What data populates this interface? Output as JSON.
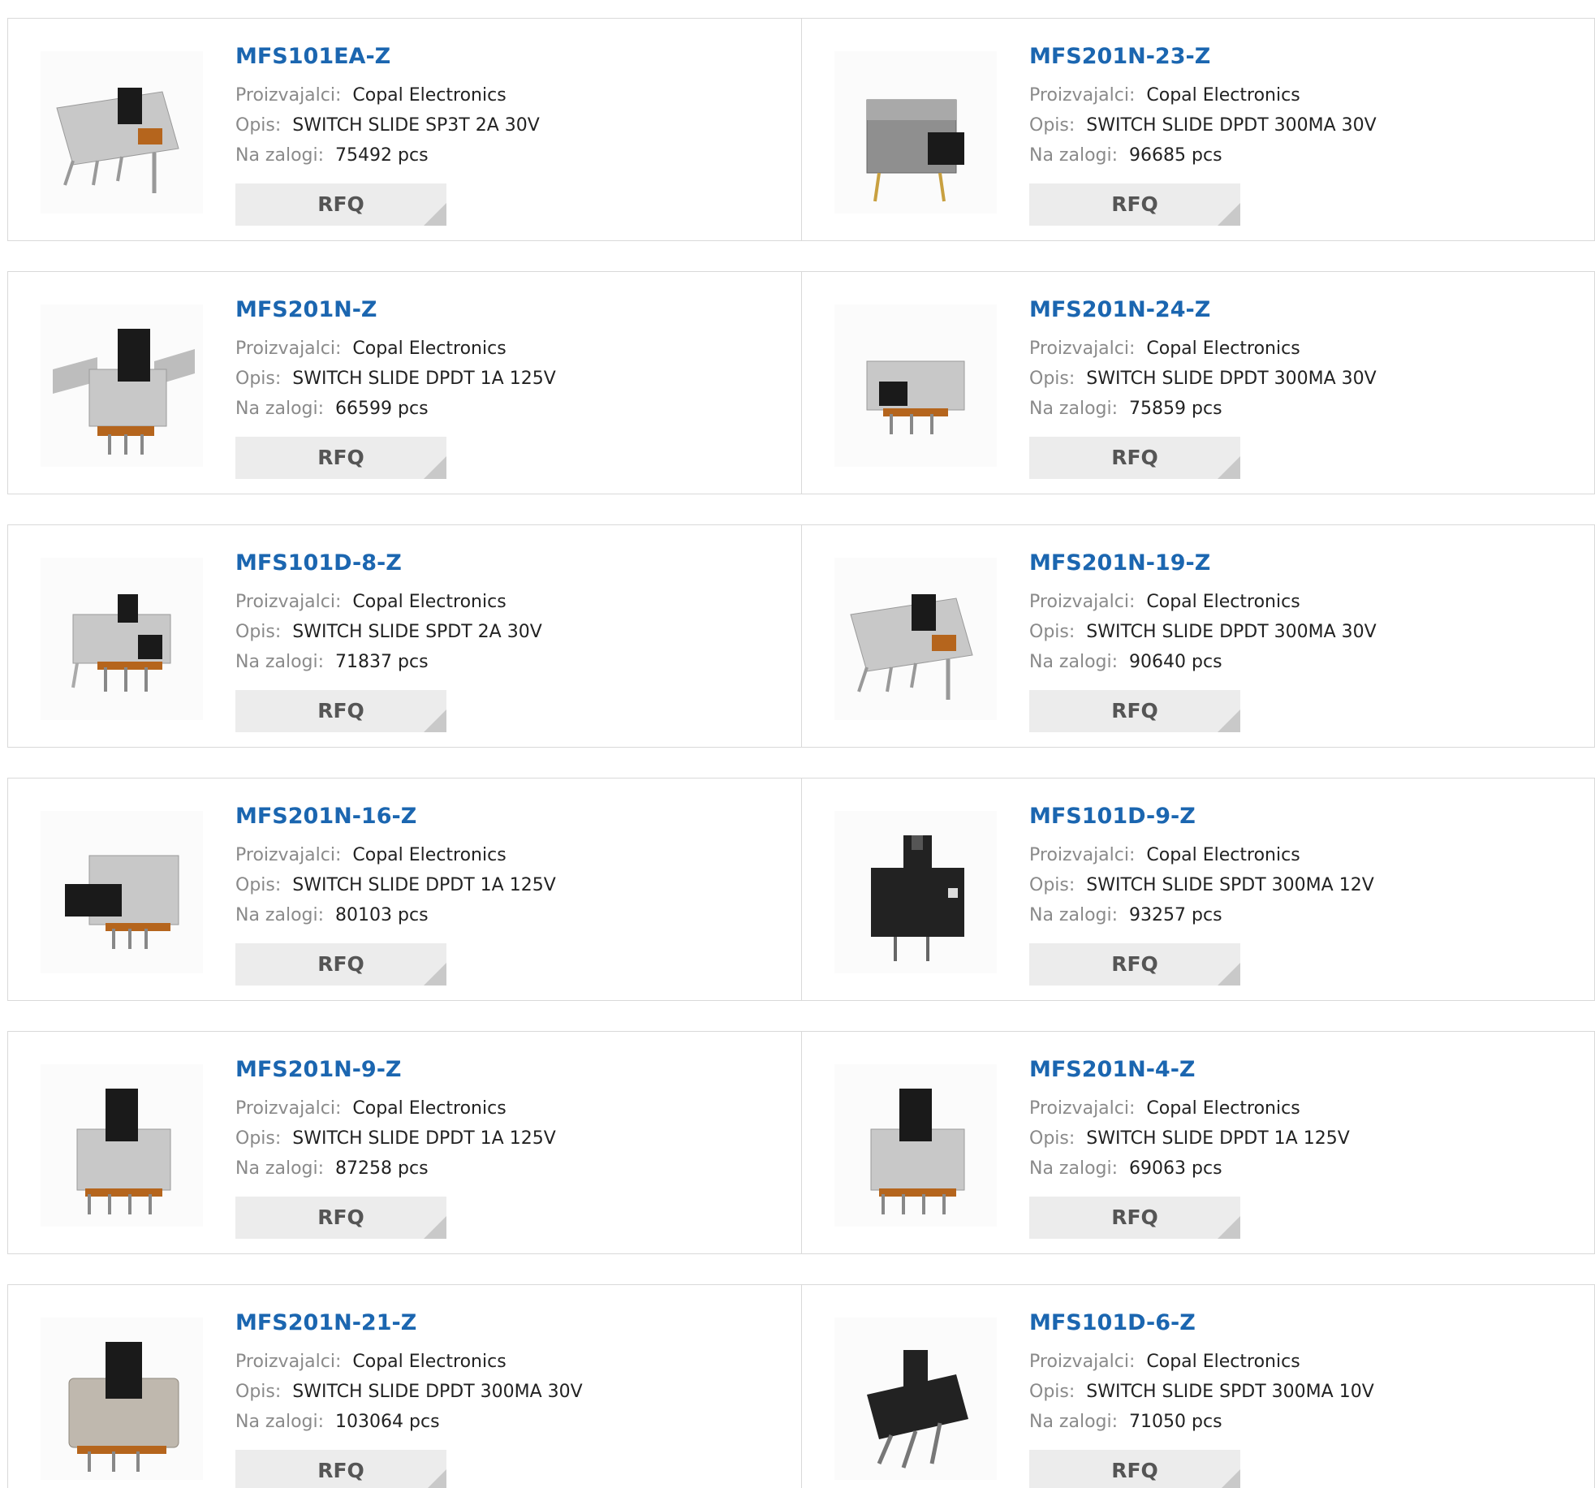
{
  "labels": {
    "manufacturer": "Proizvajalci:",
    "description": "Opis:",
    "stock": "Na zalogi:",
    "rfq_button": "RFQ"
  },
  "colors": {
    "part_number": "#1b66b0",
    "label": "#8a8a8a",
    "button_bg": "#ececec",
    "border": "#d9d9d9"
  },
  "products": [
    {
      "part_number": "MFS101EA-Z",
      "manufacturer": "Copal Electronics",
      "description": "SWITCH SLIDE SP3T 2A 30V",
      "stock": "75492 pcs",
      "image": "slide-switch-silver-angled"
    },
    {
      "part_number": "MFS201N-23-Z",
      "manufacturer": "Copal Electronics",
      "description": "SWITCH SLIDE DPDT 300MA 30V",
      "stock": "96685 pcs",
      "image": "slide-switch-grey-side"
    },
    {
      "part_number": "MFS201N-Z",
      "manufacturer": "Copal Electronics",
      "description": "SWITCH SLIDE DPDT 1A 125V",
      "stock": "66599 pcs",
      "image": "slide-switch-flanged"
    },
    {
      "part_number": "MFS201N-24-Z",
      "manufacturer": "Copal Electronics",
      "description": "SWITCH SLIDE DPDT 300MA 30V",
      "stock": "75859 pcs",
      "image": "slide-switch-small-silver"
    },
    {
      "part_number": "MFS101D-8-Z",
      "manufacturer": "Copal Electronics",
      "description": "SWITCH SLIDE SPDT 2A 30V",
      "stock": "71837 pcs",
      "image": "slide-switch-silver-small"
    },
    {
      "part_number": "MFS201N-19-Z",
      "manufacturer": "Copal Electronics",
      "description": "SWITCH SLIDE DPDT 300MA 30V",
      "stock": "90640 pcs",
      "image": "slide-switch-silver-angled"
    },
    {
      "part_number": "MFS201N-16-Z",
      "manufacturer": "Copal Electronics",
      "description": "SWITCH SLIDE DPDT 1A 125V",
      "stock": "80103 pcs",
      "image": "slide-switch-side-actuator"
    },
    {
      "part_number": "MFS101D-9-Z",
      "manufacturer": "Copal Electronics",
      "description": "SWITCH SLIDE SPDT 300MA 12V",
      "stock": "93257 pcs",
      "image": "slide-switch-black"
    },
    {
      "part_number": "MFS201N-9-Z",
      "manufacturer": "Copal Electronics",
      "description": "SWITCH SLIDE DPDT 1A 125V",
      "stock": "87258 pcs",
      "image": "slide-switch-silver-vertical"
    },
    {
      "part_number": "MFS201N-4-Z",
      "manufacturer": "Copal Electronics",
      "description": "SWITCH SLIDE DPDT 1A 125V",
      "stock": "69063 pcs",
      "image": "slide-switch-silver-vertical"
    },
    {
      "part_number": "MFS201N-21-Z",
      "manufacturer": "Copal Electronics",
      "description": "SWITCH SLIDE DPDT 300MA 30V",
      "stock": "103064 pcs",
      "image": "slide-switch-metal-case"
    },
    {
      "part_number": "MFS101D-6-Z",
      "manufacturer": "Copal Electronics",
      "description": "SWITCH SLIDE SPDT 300MA 10V",
      "stock": "71050 pcs",
      "image": "slide-switch-black-angled"
    }
  ]
}
